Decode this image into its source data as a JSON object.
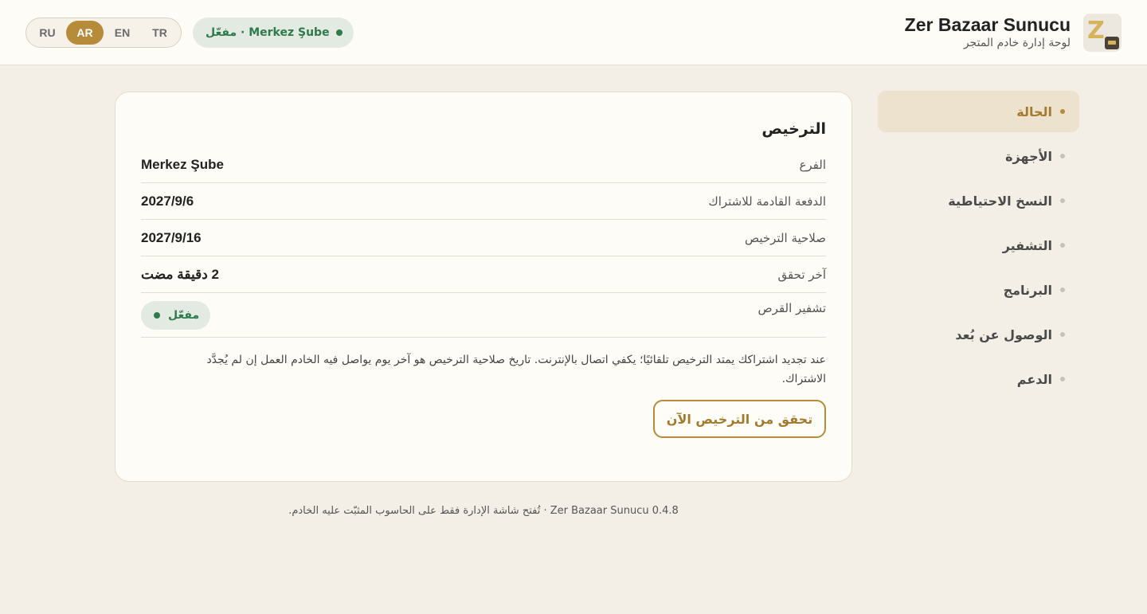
{
  "header": {
    "app_title": "Zer Bazaar Sunucu",
    "app_subtitle": "لوحة إدارة خادم المتجر",
    "languages": [
      {
        "code": "RU",
        "active": false
      },
      {
        "code": "AR",
        "active": true
      },
      {
        "code": "EN",
        "active": false
      },
      {
        "code": "TR",
        "active": false
      }
    ],
    "branch_status": "Merkez Şube · مفعّل",
    "status_color": "#2f7a4d",
    "accent_color": "#b68b3a"
  },
  "sidebar": {
    "items": [
      {
        "label": "الحالة",
        "active": true
      },
      {
        "label": "الأجهزة",
        "active": false
      },
      {
        "label": "النسخ الاحتياطية",
        "active": false
      },
      {
        "label": "التشفير",
        "active": false
      },
      {
        "label": "البرنامج",
        "active": false
      },
      {
        "label": "الوصول عن بُعد",
        "active": false
      },
      {
        "label": "الدعم",
        "active": false
      }
    ]
  },
  "license": {
    "title": "الترخيص",
    "rows": [
      {
        "label": "الفرع",
        "value": "Merkez Şube"
      },
      {
        "label": "الدفعة القادمة للاشتراك",
        "value": "2027/9/6"
      },
      {
        "label": "صلاحية الترخيص",
        "value": "2027/9/16"
      },
      {
        "label": "آخر تحقق",
        "value": "2 دقيقة مضت"
      }
    ],
    "disk_encryption_label": "تشفير القرص",
    "disk_encryption_status": "مفعّل",
    "note": "عند تجديد اشتراكك يمتد الترخيص تلقائيًا؛ يكفي اتصال بالإنترنت. تاريخ صلاحية الترخيص هو آخر يوم يواصل فيه الخادم العمل إن لم يُجدَّد الاشتراك.",
    "check_button": "تحقق من الترخيص الآن"
  },
  "footer": {
    "text": "Zer Bazaar Sunucu 0.4.8 · تُفتح شاشة الإدارة فقط على الحاسوب المثبّت عليه الخادم."
  }
}
